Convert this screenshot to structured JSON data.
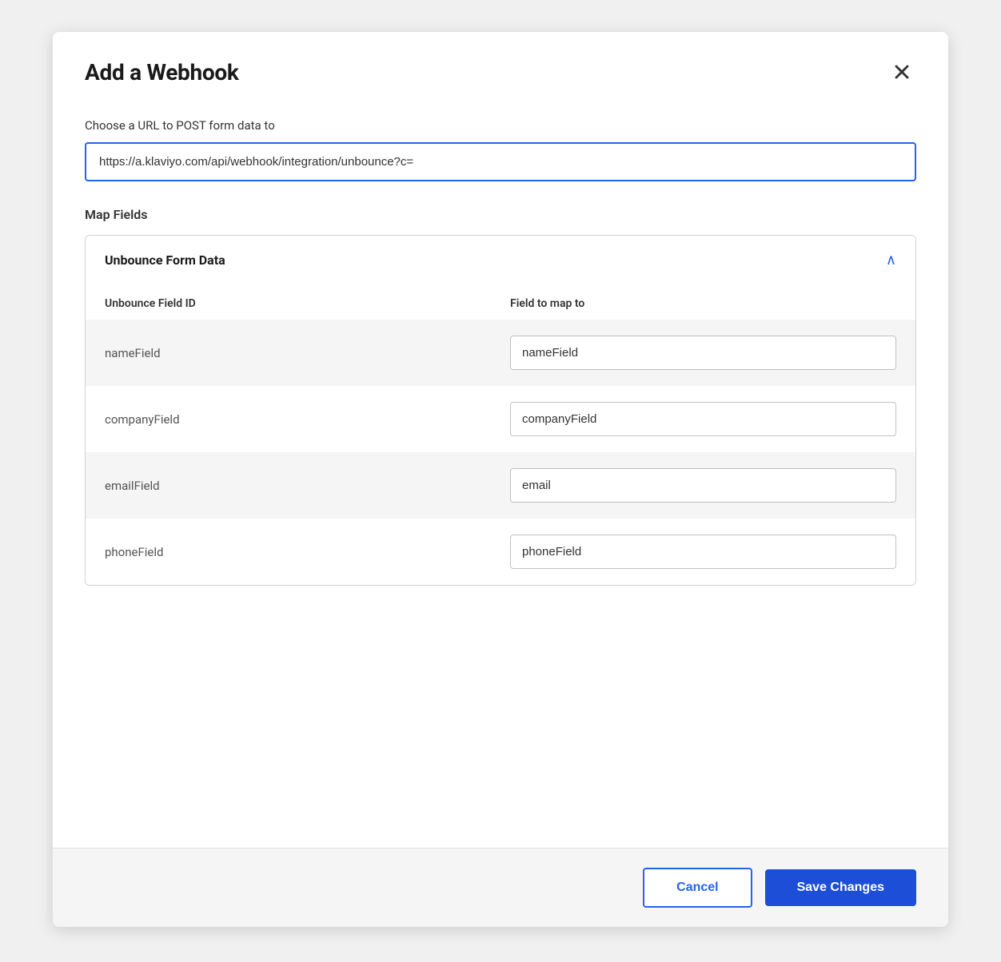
{
  "modal": {
    "title": "Add a Webhook",
    "close_label": "×"
  },
  "url_section": {
    "label": "Choose a URL to POST form data to",
    "url_value": "https://a.klaviyo.com/api/webhook/integration/unbounce?c=",
    "url_placeholder": "https://a.klaviyo.com/api/webhook/integration/unbounce?c="
  },
  "map_fields": {
    "label": "Map Fields",
    "card_title": "Unbounce Form Data",
    "chevron": "∧",
    "columns": {
      "field_id": "Unbounce Field ID",
      "map_to": "Field to map to"
    },
    "rows": [
      {
        "id": "nameField",
        "map_value": "nameField"
      },
      {
        "id": "companyField",
        "map_value": "companyField"
      },
      {
        "id": "emailField",
        "map_value": "email"
      },
      {
        "id": "phoneField",
        "map_value": "phoneField"
      }
    ]
  },
  "footer": {
    "cancel_label": "Cancel",
    "save_label": "Save Changes"
  }
}
